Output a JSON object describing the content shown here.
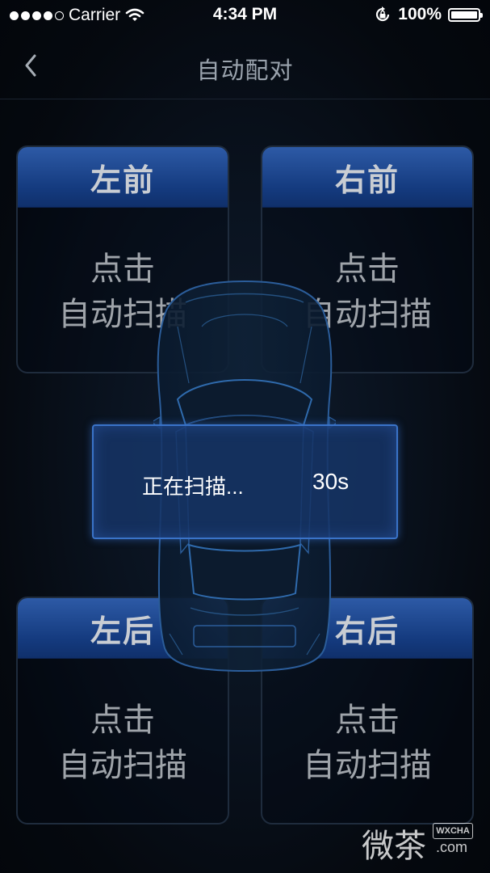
{
  "status_bar": {
    "carrier": "Carrier",
    "time": "4:34 PM",
    "battery": "100%"
  },
  "nav": {
    "title": "自动配对"
  },
  "cards": {
    "front_left": {
      "title": "左前",
      "line1": "点击",
      "line2": "自动扫描"
    },
    "front_right": {
      "title": "右前",
      "line1": "点击",
      "line2": "自动扫描"
    },
    "rear_left": {
      "title": "左后",
      "line1": "点击",
      "line2": "自动扫描"
    },
    "rear_right": {
      "title": "右后",
      "line1": "点击",
      "line2": "自动扫描"
    }
  },
  "scan": {
    "status": "正在扫描...",
    "countdown": "30s"
  },
  "watermark": {
    "chars": "微茶",
    "badge": "WXCHA",
    "domain": ".com"
  },
  "colors": {
    "card_header": "#1d4a94",
    "dialog_border": "#3a73c8",
    "background": "#05090f"
  },
  "icons": [
    "signal-dots-icon",
    "wifi-icon",
    "rotation-lock-icon",
    "battery-icon",
    "back-chevron-icon",
    "car-outline-icon"
  ]
}
